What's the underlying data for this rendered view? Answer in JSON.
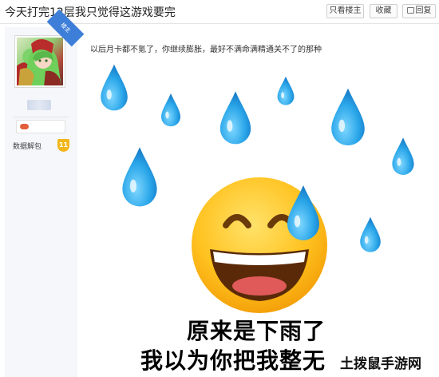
{
  "header": {
    "title": "今天打完12层我只觉得这游戏要完",
    "only_op_label": "只看楼主",
    "favorite_label": "收藏",
    "reply_label": "回复",
    "reply_icon": "comment-icon"
  },
  "author": {
    "op_badge": "楼主",
    "avatar_icon": "anime-avatar",
    "game_icon": "gamepad-icon",
    "title_label": "数据解包",
    "level": "11"
  },
  "post": {
    "text": "以后月卡都不氪了，你继续膨胀，最好不满命满精通关不了的那种",
    "meme": {
      "line1": "原来是下雨了",
      "line2": "我以为你把我整无",
      "emoji": "sweat-smile-emoji",
      "drop_color": "#29a7e8"
    }
  },
  "watermark": "土拨鼠手游网"
}
